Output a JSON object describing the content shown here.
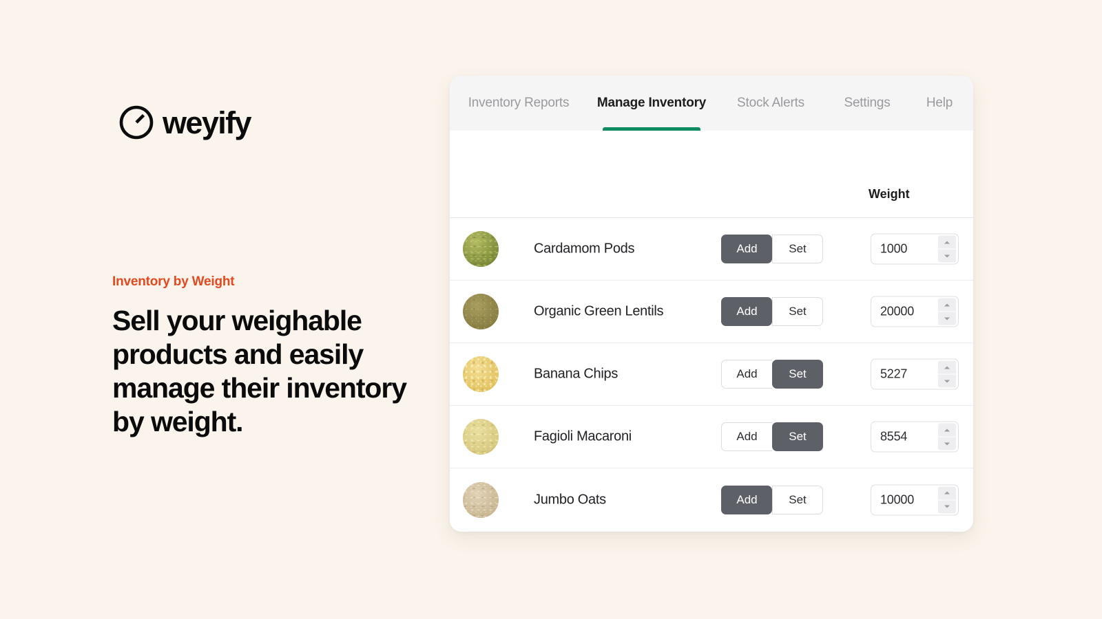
{
  "brand": {
    "logo_icon": "gauge-circle-icon",
    "name": "weyify"
  },
  "marketing": {
    "eyebrow": "Inventory by Weight",
    "headline": "Sell your weighable products and easily manage their inventory by weight.",
    "eyebrow_color": "#e3491f",
    "background_color": "#faf4ec"
  },
  "app": {
    "accent_color": "#0e8b60",
    "active_button_color": "#5d6167",
    "tabs": [
      {
        "label": "Inventory Reports",
        "active": false
      },
      {
        "label": "Manage Inventory",
        "active": true
      },
      {
        "label": "Stock Alerts",
        "active": false
      },
      {
        "label": "Settings",
        "active": false
      },
      {
        "label": "Help",
        "active": false
      }
    ],
    "table": {
      "columns": {
        "product": "",
        "mode": "",
        "weight": "Weight"
      },
      "mode_options": {
        "add": "Add",
        "set": "Set"
      },
      "rows": [
        {
          "thumb": "cardamom-pods-thumbnail",
          "name": "Cardamom Pods",
          "mode": "Add",
          "add_label": "Add",
          "set_label": "Set",
          "weight": "1000"
        },
        {
          "thumb": "green-lentils-thumbnail",
          "name": "Organic Green Lentils",
          "mode": "Add",
          "add_label": "Add",
          "set_label": "Set",
          "weight": "20000"
        },
        {
          "thumb": "banana-chips-thumbnail",
          "name": "Banana Chips",
          "mode": "Set",
          "add_label": "Add",
          "set_label": "Set",
          "weight": "5227"
        },
        {
          "thumb": "fagioli-macaroni-thumbnail",
          "name": "Fagioli Macaroni",
          "mode": "Set",
          "add_label": "Add",
          "set_label": "Set",
          "weight": "8554"
        },
        {
          "thumb": "jumbo-oats-thumbnail",
          "name": "Jumbo Oats",
          "mode": "Add",
          "add_label": "Add",
          "set_label": "Set",
          "weight": "10000"
        }
      ]
    }
  }
}
